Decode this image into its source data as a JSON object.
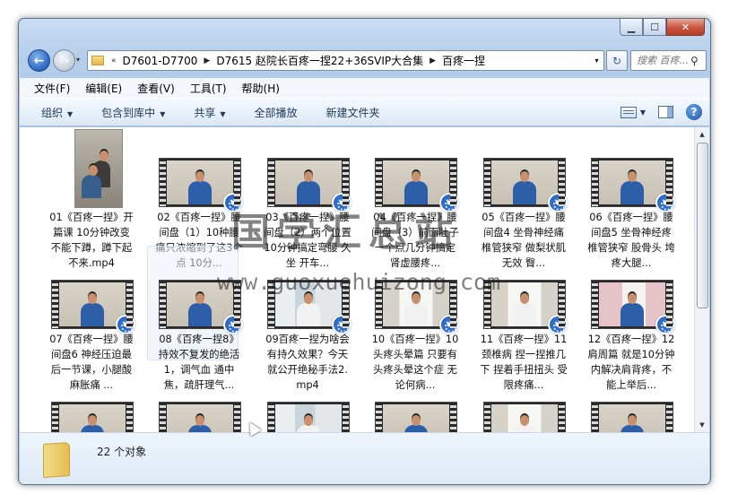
{
  "window": {
    "caption": {
      "minimize": "▁",
      "maximize": "☐",
      "close": "✕"
    }
  },
  "nav": {
    "back": "←",
    "forward": "→",
    "recent": "▾",
    "address": {
      "overflow": "«",
      "crumbs": [
        "D7601-D7700",
        "D7615 赵院长百疼一捏22+36SVIP大合集",
        "百疼一捏"
      ],
      "dropdown": "▾"
    },
    "refresh": "↻",
    "search_placeholder": "搜索 百疼..."
  },
  "menu": [
    "文件(F)",
    "编辑(E)",
    "查看(V)",
    "工具(T)",
    "帮助(H)"
  ],
  "toolbar": {
    "organize": "组织",
    "include_library": "包含到库中",
    "share": "共享",
    "play_all": "全部播放",
    "new_folder": "新建文件夹",
    "help": "?"
  },
  "files": [
    {
      "name": "01《百疼一捏》开篇课 10分钟改变  不能下蹲，蹲下起不来.mp4",
      "scene": "portrait"
    },
    {
      "name": "02《百疼一捏》腰间盘（1）10种腰痛只浓缩到了这3个点 10分...",
      "scene": "room"
    },
    {
      "name": "03《百疼一捏》腰间盘（2）两个位置 10分钟搞定弯腰 久坐 开车...",
      "scene": "room"
    },
    {
      "name": "04《百疼一捏》腰间盘（3）前面肚子一个点几分钟搞定肾虚腰疼...",
      "scene": "room"
    },
    {
      "name": "05《百疼一捏》腰间盘4 坐骨神经痛椎管狭窄 做梨状肌无效 臀...",
      "scene": "room"
    },
    {
      "name": "06《百疼一捏》腰间盘5 坐骨神经疼 椎管狭窄 股骨头 垮疼大腿...",
      "scene": "room"
    },
    {
      "name": "07《百疼一捏》腰间盘6 神经压迫最后一节课，小腿酸麻胀痛 ...",
      "scene": "room"
    },
    {
      "name": "08《百疼一捏8》持效不复发的绝活1，调气血  通中焦，疏肝理气...",
      "scene": "room",
      "selected": true
    },
    {
      "name": "09百疼一捏为啥会有持久效果？今天就公开绝秘手法2.mp4",
      "scene": "window"
    },
    {
      "name": "10《百疼一捏》10头疼头晕篇 只要有头疼头晕这个症 无论何病...",
      "scene": "board"
    },
    {
      "name": "11《百疼一捏》11颈椎病 捏一捏推几下 捏着手扭扭头 受限疼痛...",
      "scene": "board"
    },
    {
      "name": "12《百疼一捏》12肩周篇 就是10分钟内解决肩背疼，不能上举后...",
      "scene": "pink"
    },
    {
      "name": "",
      "scene": "room"
    },
    {
      "name": "",
      "scene": "room"
    },
    {
      "name": "",
      "scene": "window"
    },
    {
      "name": "",
      "scene": "room"
    },
    {
      "name": "",
      "scene": "board"
    },
    {
      "name": "",
      "scene": "room"
    }
  ],
  "status": {
    "count_text": "22 个对象"
  },
  "watermark": {
    "title": "国学汇总站",
    "url": "www.guoxuehuizong.com"
  }
}
